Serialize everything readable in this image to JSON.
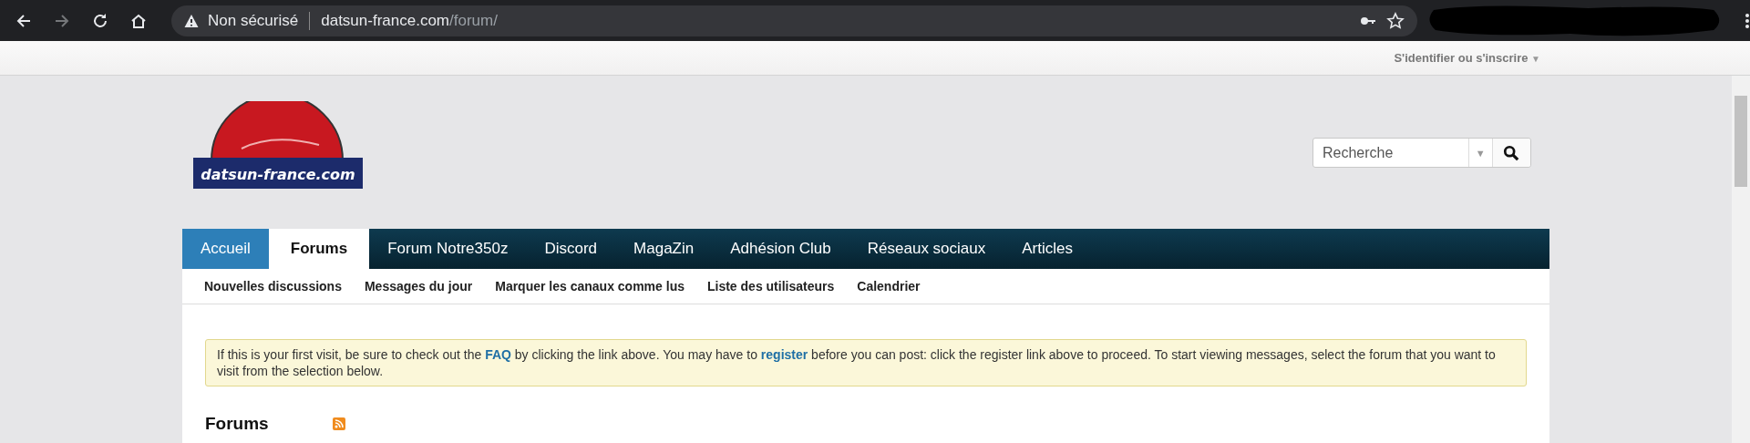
{
  "browser": {
    "security": "Non sécurisé",
    "url_host": "datsun-france.com",
    "url_path": "/forum/"
  },
  "top_bar": {
    "login": "S'identifier ou s'inscrire",
    "caret": "▼"
  },
  "logo": {
    "text": "datsun-france.com"
  },
  "search": {
    "placeholder": "Recherche",
    "caret": "▼"
  },
  "nav": [
    {
      "label": "Accueil",
      "selected": false,
      "kind": "home"
    },
    {
      "label": "Forums",
      "selected": true,
      "kind": "tab"
    },
    {
      "label": "Forum Notre350z",
      "selected": false,
      "kind": "tab"
    },
    {
      "label": "Discord",
      "selected": false,
      "kind": "tab"
    },
    {
      "label": "MagaZin",
      "selected": false,
      "kind": "tab"
    },
    {
      "label": "Adhésion Club",
      "selected": false,
      "kind": "tab"
    },
    {
      "label": "Réseaux sociaux",
      "selected": false,
      "kind": "tab"
    },
    {
      "label": "Articles",
      "selected": false,
      "kind": "tab"
    }
  ],
  "subnav": [
    "Nouvelles discussions",
    "Messages du jour",
    "Marquer les canaux comme lus",
    "Liste des utilisateurs",
    "Calendrier"
  ],
  "notice": {
    "before": "If this is your first visit, be sure to check out the",
    "faq": "FAQ",
    "middle": "by clicking the link above. You may have to",
    "register": "register",
    "after": "before you can post: click the register link above to proceed. To start viewing messages, select the forum that you want to visit from the selection below."
  },
  "section": {
    "title": "Forums"
  }
}
